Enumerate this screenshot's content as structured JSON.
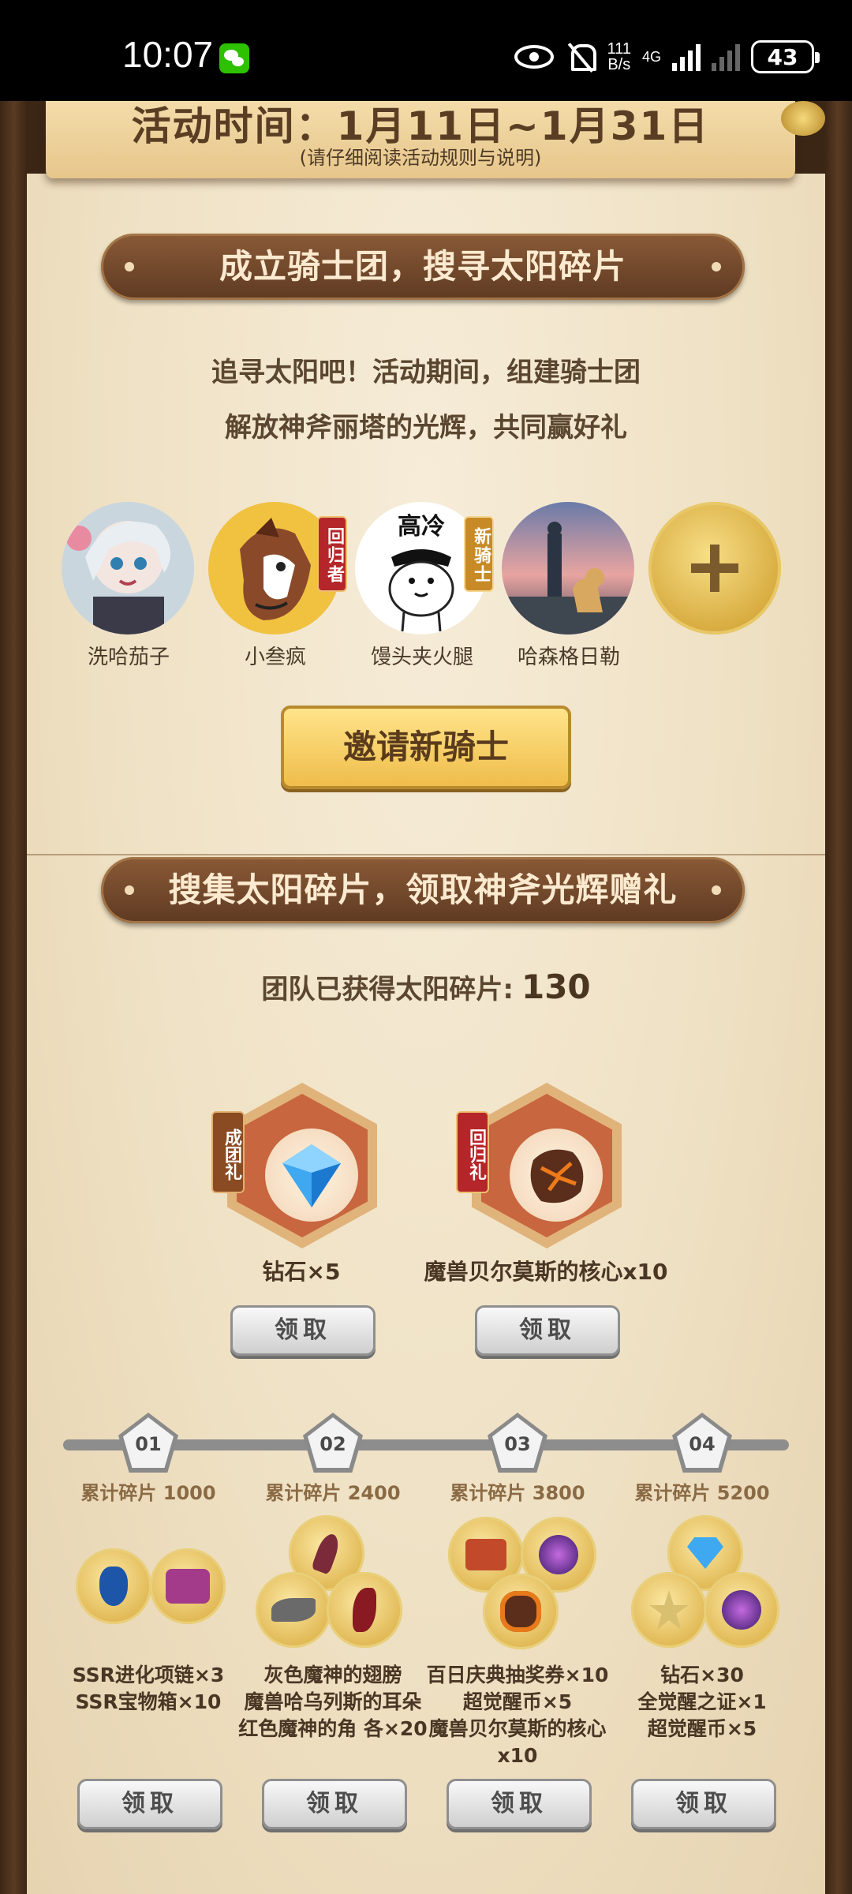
{
  "status_bar": {
    "time": "10:07",
    "net_speed_value": "111",
    "net_speed_unit": "B/s",
    "network": "4G",
    "battery": "43"
  },
  "top_banner": {
    "title": "活动时间：1月11日~1月31日",
    "subtitle": "(请仔细阅读活动规则与说明)"
  },
  "section1": {
    "header": "成立骑士团，搜寻太阳碎片",
    "desc_line1": "追寻太阳吧！活动期间，组建骑士团",
    "desc_line2": "解放神斧丽塔的光辉，共同赢好礼",
    "members": [
      {
        "name": "洗哈茄子",
        "tag": ""
      },
      {
        "name": "小叁疯",
        "tag": "回归者"
      },
      {
        "name": "馒头夹火腿",
        "tag": "新骑士",
        "avatar_text": "高冷"
      },
      {
        "name": "哈森格日勒",
        "tag": ""
      }
    ],
    "invite_button": "邀请新骑士"
  },
  "section2": {
    "header": "搜集太阳碎片，领取神斧光辉赠礼",
    "shards_label": "团队已获得太阳碎片:",
    "shards_value": "130",
    "rewards": [
      {
        "tag": "成团礼",
        "name": "钻石×5",
        "claim": "领取"
      },
      {
        "tag": "回归礼",
        "name": "魔兽贝尔莫斯的核心x10",
        "claim": "领取"
      }
    ],
    "milestones": [
      {
        "num": "01",
        "label": "累计碎片 1000",
        "items": [
          "SSR进化项链×3",
          "SSR宝物箱×10"
        ],
        "claim": "领取"
      },
      {
        "num": "02",
        "label": "累计碎片 2400",
        "items": [
          "灰色魔神的翅膀",
          "魔兽哈乌列斯的耳朵",
          "红色魔神的角 各×20"
        ],
        "claim": "领取"
      },
      {
        "num": "03",
        "label": "累计碎片 3800",
        "items": [
          "百日庆典抽奖券×10",
          "超觉醒币×5",
          "魔兽贝尔莫斯的核心",
          "x10"
        ],
        "claim": "领取"
      },
      {
        "num": "04",
        "label": "累计碎片 5200",
        "items": [
          "钻石×30",
          "全觉醒之证×1",
          "超觉醒币×5"
        ],
        "claim": "领取"
      }
    ]
  },
  "colors": {
    "parchment": "#efe1c4",
    "header_brown": "#6f4629",
    "gold_button": "#f3c656",
    "tag_red": "#b5262a",
    "tag_gold": "#c78a26"
  }
}
